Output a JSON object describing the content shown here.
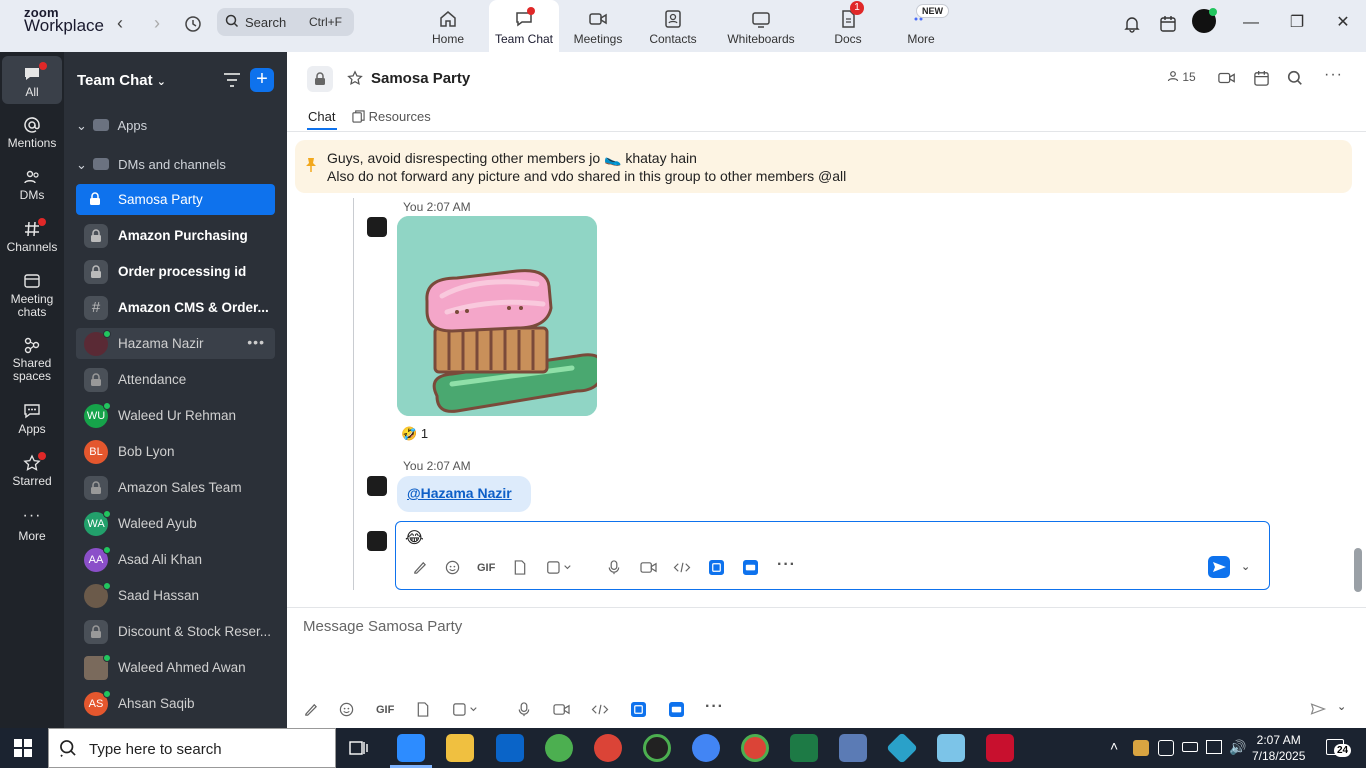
{
  "topbar": {
    "logo_line1": "zoom",
    "logo_line2": "Workplace",
    "search_label": "Search",
    "search_shortcut": "Ctrl+F",
    "tabs": [
      {
        "label": "Home"
      },
      {
        "label": "Team Chat"
      },
      {
        "label": "Meetings"
      },
      {
        "label": "Contacts"
      },
      {
        "label": "Whiteboards"
      },
      {
        "label": "Docs",
        "badge": "1"
      },
      {
        "label": "More",
        "badge": "NEW"
      }
    ]
  },
  "rail": {
    "items": [
      {
        "label": "All"
      },
      {
        "label": "Mentions"
      },
      {
        "label": "DMs"
      },
      {
        "label": "Channels"
      },
      {
        "label": "Meeting chats"
      },
      {
        "label": "Shared spaces"
      },
      {
        "label": "Apps"
      },
      {
        "label": "Starred"
      },
      {
        "label": "More"
      }
    ]
  },
  "sidebar": {
    "title": "Team Chat",
    "sections": {
      "apps": "Apps",
      "dms": "DMs and channels"
    },
    "items": [
      {
        "label": "Samosa Party",
        "initials": ""
      },
      {
        "label": "Amazon Purchasing",
        "initials": ""
      },
      {
        "label": "Order processing id",
        "initials": ""
      },
      {
        "label": "Amazon CMS & Order...",
        "initials": ""
      },
      {
        "label": "Hazama Nazir",
        "initials": ""
      },
      {
        "label": "Attendance",
        "initials": ""
      },
      {
        "label": "Waleed Ur Rehman",
        "initials": "WU"
      },
      {
        "label": "Bob Lyon",
        "initials": "BL"
      },
      {
        "label": "Amazon Sales Team",
        "initials": ""
      },
      {
        "label": "Waleed Ayub",
        "initials": "WA"
      },
      {
        "label": "Asad Ali Khan",
        "initials": "AA"
      },
      {
        "label": "Saad Hassan",
        "initials": ""
      },
      {
        "label": "Discount & Stock Reser...",
        "initials": ""
      },
      {
        "label": "Waleed Ahmed Awan",
        "initials": ""
      },
      {
        "label": "Ahsan Saqib",
        "initials": "AS"
      }
    ]
  },
  "chat": {
    "channel_name": "Samosa Party",
    "member_count": "15",
    "tabs": {
      "chat": "Chat",
      "resources": "Resources"
    },
    "pinned_line1": "Guys, avoid disrespecting other members jo 🥿 khatay hain",
    "pinned_line2": "Also do not forward any picture and vdo shared in this group to other members @all",
    "messages": [
      {
        "meta": "You 2:07 AM",
        "reaction_emoji": "🤣",
        "reaction_count": "1"
      },
      {
        "meta": "You 2:07 AM",
        "mention": "@Hazama Nazir"
      }
    ],
    "editing_emoji": "😂",
    "toolbar_gif": "GIF",
    "compose_placeholder": "Message Samosa Party"
  },
  "taskbar": {
    "search_placeholder": "Type here to search",
    "time": "2:07 AM",
    "date": "7/18/2025",
    "notifications": "24"
  },
  "colors": {
    "accent": "#0e72ed",
    "rail_bg": "#1f2329",
    "sidebar_bg": "#2b3038",
    "pinned_bg": "#fdf4e3"
  }
}
